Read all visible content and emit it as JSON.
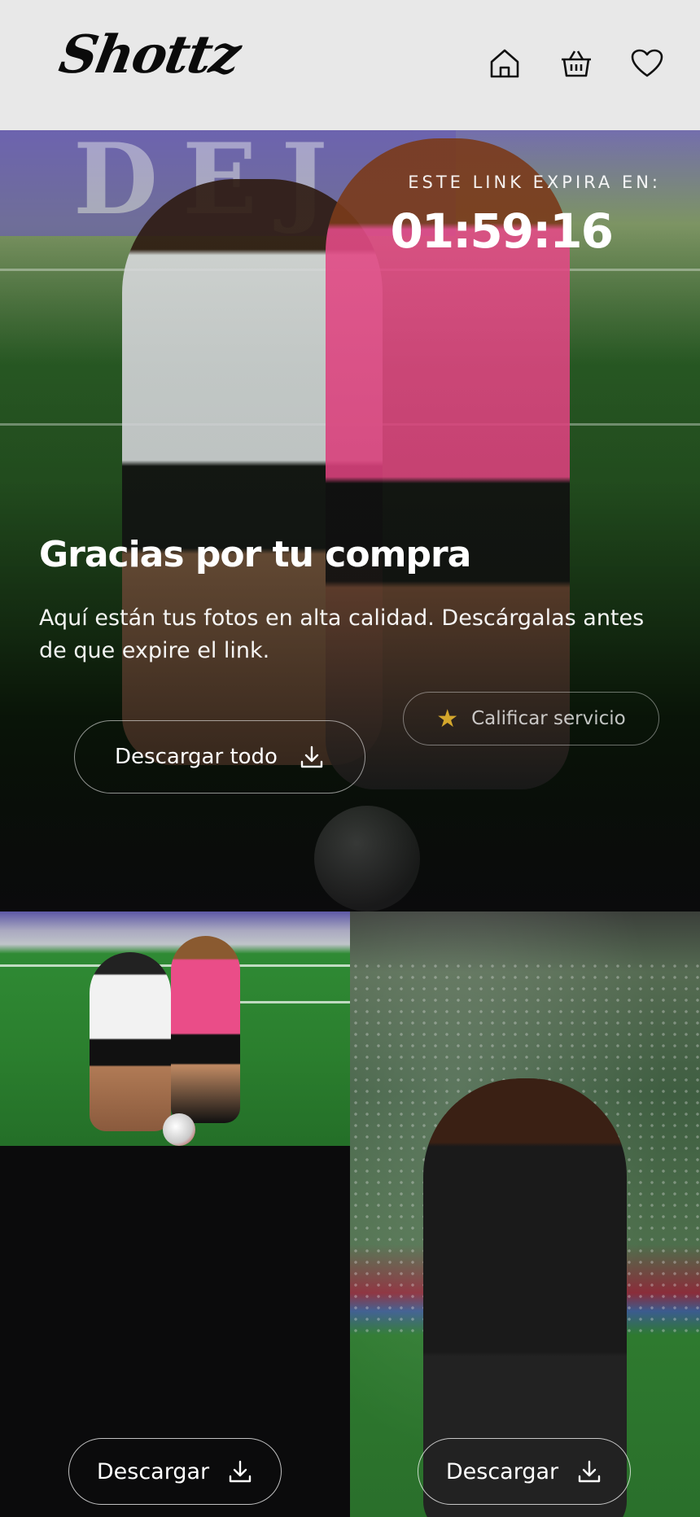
{
  "header": {
    "logo_text": "Shottz",
    "nav": [
      {
        "name": "home",
        "icon": "home-icon"
      },
      {
        "name": "basket",
        "icon": "basket-icon"
      },
      {
        "name": "favorites",
        "icon": "heart-icon"
      }
    ]
  },
  "hero": {
    "expire_label": "ESTE LINK EXPIRA EN:",
    "timer": "01:59:16",
    "title": "Gracias por tu compra",
    "subtitle": "Aquí están tus fotos en alta calidad. Descárgalas antes de que expire el link.",
    "rate_button": {
      "label": "Calificar servicio",
      "icon": "star-icon"
    },
    "download_all_button": {
      "label": "Descargar todo",
      "icon": "download-icon"
    }
  },
  "gallery": {
    "items": [
      {
        "button_label": "Descargar",
        "icon": "download-icon"
      },
      {
        "button_label": "Descargar",
        "icon": "download-icon"
      }
    ]
  },
  "colors": {
    "header_bg": "#e8e8e8",
    "page_bg": "#0b0b0c",
    "star": "#d4a72c"
  }
}
